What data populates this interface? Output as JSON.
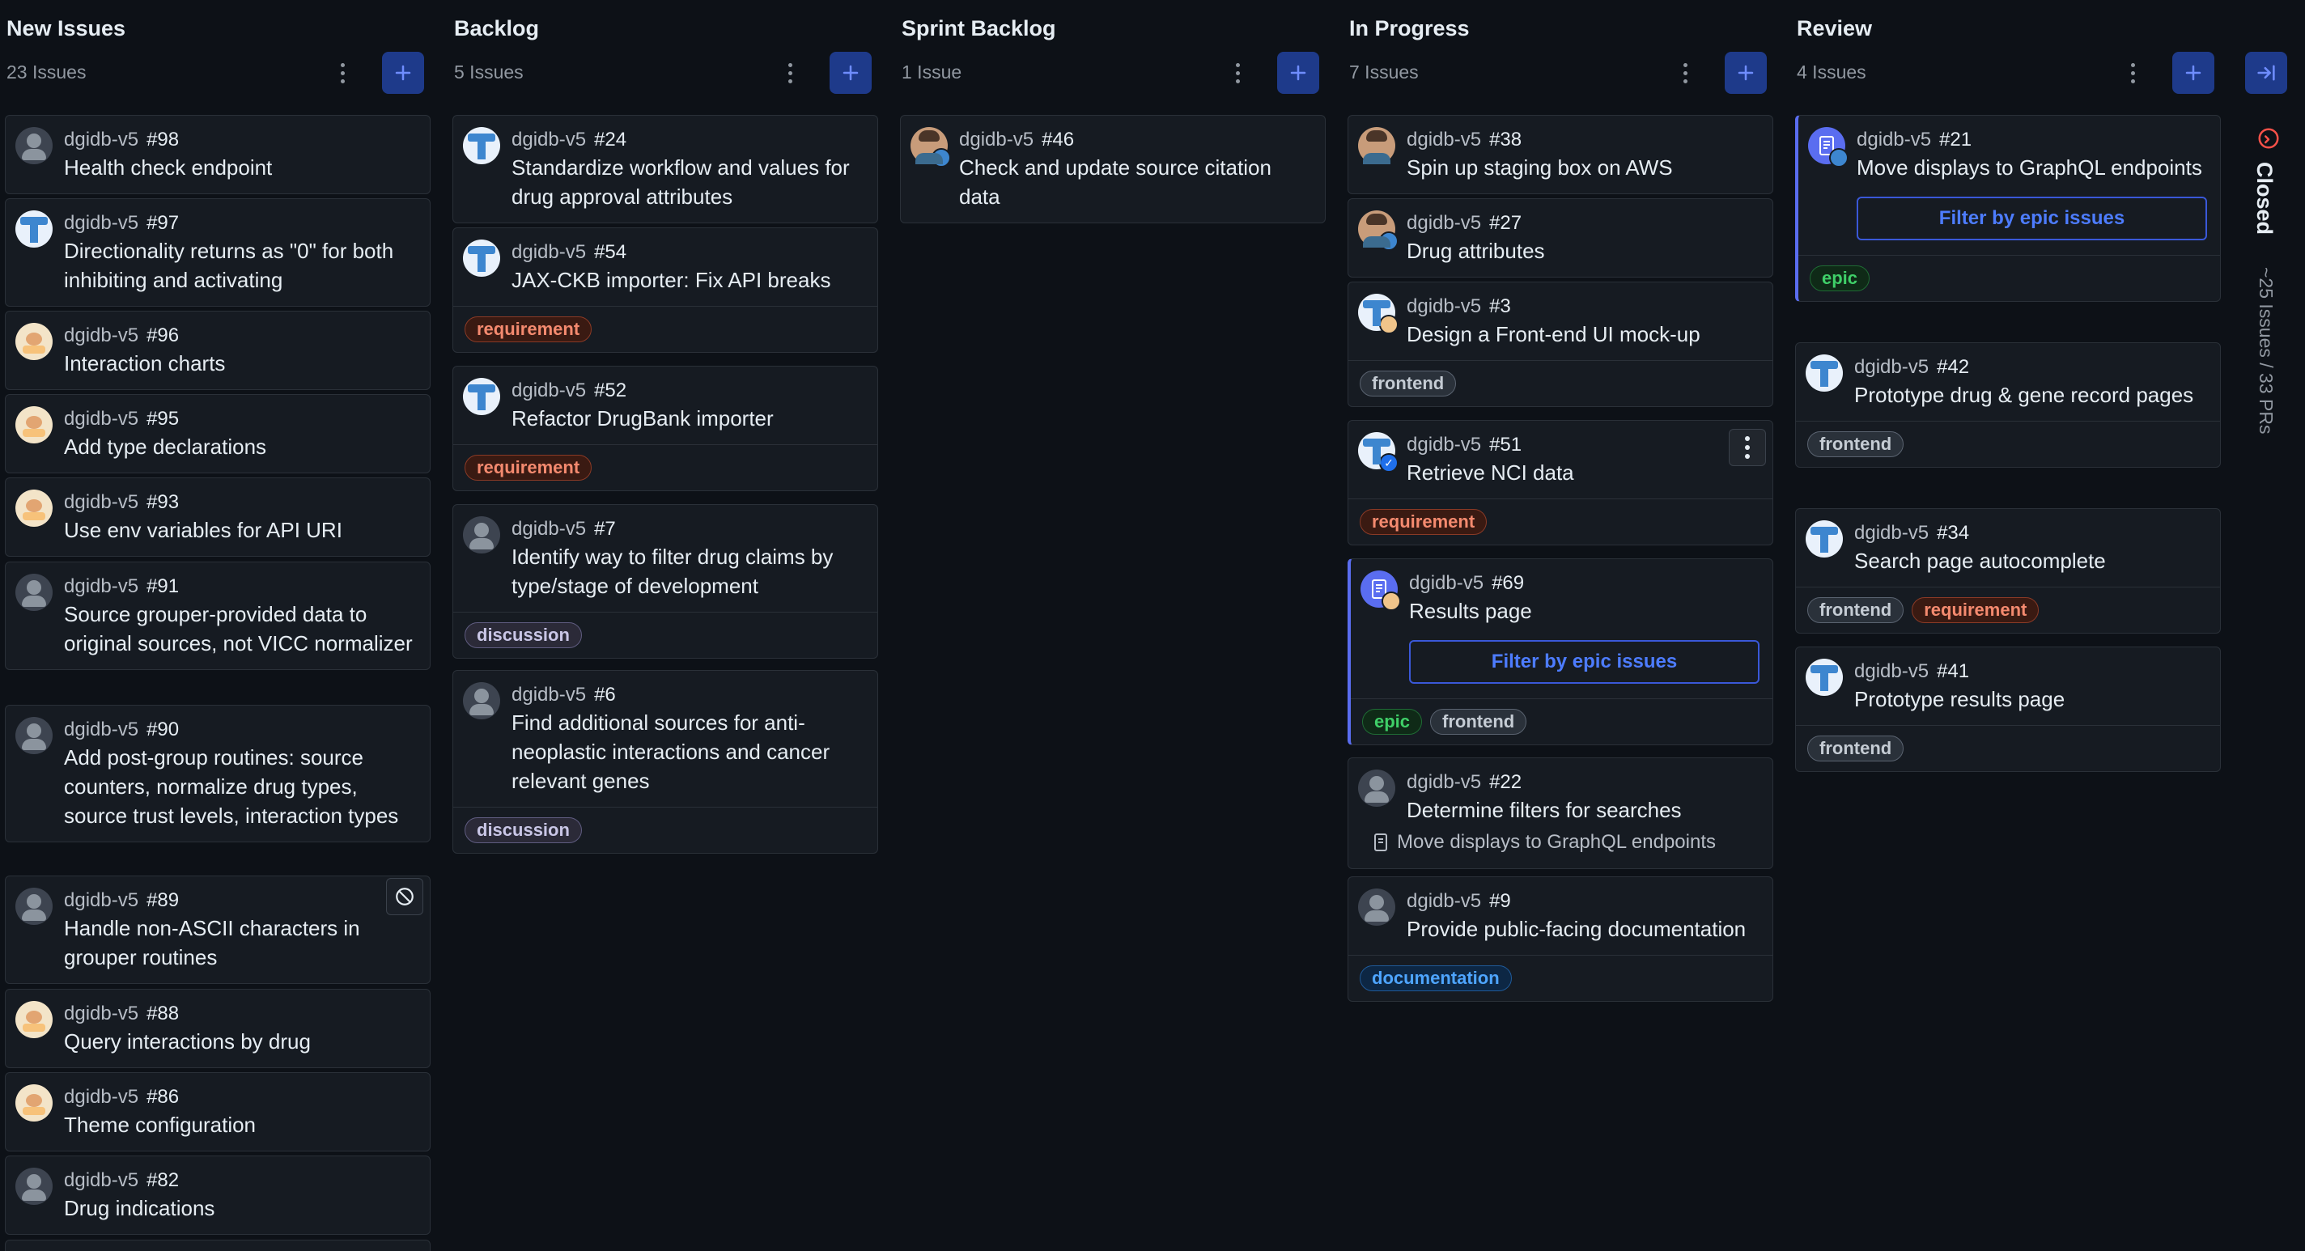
{
  "colors": {
    "background": "#0d1117",
    "card": "#161b22",
    "accent": "#1e3a8a",
    "epic_border": "#5a6df0"
  },
  "columns": [
    {
      "title": "New Issues",
      "count": "23 Issues",
      "cards": [
        {
          "repo": "dgidb-v5",
          "number": "#98",
          "title": "Health check endpoint"
        },
        {
          "repo": "dgidb-v5",
          "number": "#97",
          "title": "Directionality returns as \"0\" for both inhibiting and activating"
        },
        {
          "repo": "dgidb-v5",
          "number": "#96",
          "title": "Interaction charts"
        },
        {
          "repo": "dgidb-v5",
          "number": "#95",
          "title": "Add type declarations"
        },
        {
          "repo": "dgidb-v5",
          "number": "#93",
          "title": "Use env variables for API URI"
        },
        {
          "repo": "dgidb-v5",
          "number": "#91",
          "title": "Source grouper-provided data to original sources, not VICC normalizer"
        },
        {
          "repo": "dgidb-v5",
          "number": "#90",
          "title": "Add post-group routines: source counters, normalize drug types, source trust levels, interaction types"
        },
        {
          "repo": "dgidb-v5",
          "number": "#89",
          "title": "Handle non-ASCII characters in grouper routines"
        },
        {
          "repo": "dgidb-v5",
          "number": "#88",
          "title": "Query interactions by drug"
        },
        {
          "repo": "dgidb-v5",
          "number": "#86",
          "title": "Theme configuration"
        },
        {
          "repo": "dgidb-v5",
          "number": "#82",
          "title": "Drug indications"
        }
      ]
    },
    {
      "title": "Backlog",
      "count": "5 Issues",
      "cards": [
        {
          "repo": "dgidb-v5",
          "number": "#24",
          "title": "Standardize workflow and values for drug approval attributes"
        },
        {
          "repo": "dgidb-v5",
          "number": "#54",
          "title": "JAX-CKB importer: Fix API breaks",
          "labels": [
            "requirement"
          ]
        },
        {
          "repo": "dgidb-v5",
          "number": "#52",
          "title": "Refactor DrugBank importer",
          "labels": [
            "requirement"
          ]
        },
        {
          "repo": "dgidb-v5",
          "number": "#7",
          "title": "Identify way to filter drug claims by type/stage of development",
          "labels": [
            "discussion"
          ]
        },
        {
          "repo": "dgidb-v5",
          "number": "#6",
          "title": "Find additional sources for anti-neoplastic interactions and cancer relevant genes",
          "labels": [
            "discussion"
          ]
        }
      ]
    },
    {
      "title": "Sprint Backlog",
      "count": "1 Issue",
      "cards": [
        {
          "repo": "dgidb-v5",
          "number": "#46",
          "title": "Check and update source citation data"
        }
      ]
    },
    {
      "title": "In Progress",
      "count": "7 Issues",
      "cards": [
        {
          "repo": "dgidb-v5",
          "number": "#38",
          "title": "Spin up staging box on AWS"
        },
        {
          "repo": "dgidb-v5",
          "number": "#27",
          "title": "Drug attributes"
        },
        {
          "repo": "dgidb-v5",
          "number": "#3",
          "title": "Design a Front-end UI mock-up",
          "labels": [
            "frontend"
          ]
        },
        {
          "repo": "dgidb-v5",
          "number": "#51",
          "title": "Retrieve NCI data",
          "labels": [
            "requirement"
          ]
        },
        {
          "repo": "dgidb-v5",
          "number": "#69",
          "title": "Results page",
          "epic_button": "Filter by epic issues",
          "labels": [
            "epic",
            "frontend"
          ]
        },
        {
          "repo": "dgidb-v5",
          "number": "#22",
          "title": "Determine filters for searches",
          "parent": "Move displays to GraphQL endpoints"
        },
        {
          "repo": "dgidb-v5",
          "number": "#9",
          "title": "Provide public-facing documentation",
          "labels": [
            "documentation"
          ]
        }
      ]
    },
    {
      "title": "Review",
      "count": "4 Issues",
      "cards": [
        {
          "repo": "dgidb-v5",
          "number": "#21",
          "title": "Move displays to GraphQL endpoints",
          "epic_button": "Filter by epic issues",
          "labels": [
            "epic"
          ]
        },
        {
          "repo": "dgidb-v5",
          "number": "#42",
          "title": "Prototype drug & gene record pages",
          "labels": [
            "frontend"
          ]
        },
        {
          "repo": "dgidb-v5",
          "number": "#34",
          "title": "Search page autocomplete",
          "labels": [
            "frontend",
            "requirement"
          ]
        },
        {
          "repo": "dgidb-v5",
          "number": "#41",
          "title": "Prototype results page",
          "labels": [
            "frontend"
          ]
        }
      ]
    }
  ],
  "closed": {
    "label": "Closed",
    "count": "~25 Issues / 33 PRs"
  }
}
